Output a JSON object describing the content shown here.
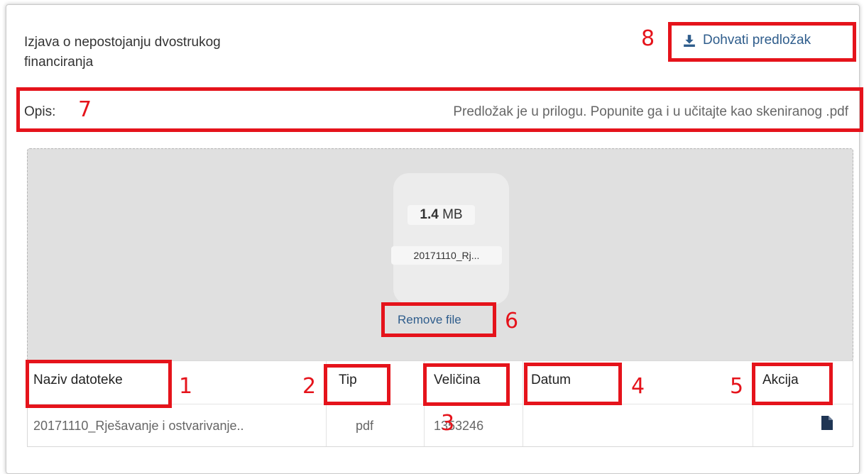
{
  "header": {
    "title": "Izjava o nepostojanju dvostrukog financiranja",
    "template_link": "Dohvati predložak",
    "template_icon": "download-icon"
  },
  "description": {
    "label": "Opis:",
    "text": "Predložak je u prilogu. Popunite ga i u učitajte kao skeniranog .pdf"
  },
  "dropzone": {
    "file_size_value": "1.4",
    "file_size_unit": "MB",
    "file_name": "20171110_Rj...",
    "remove_label": "Remove file"
  },
  "table": {
    "columns": [
      "Naziv datoteke",
      "Tip",
      "Veličina",
      "Datum",
      "Akcija"
    ],
    "rows": [
      {
        "name": "20171110_Rješavanje i ostvarivanje..",
        "type": "pdf",
        "size": "1353246",
        "date": "",
        "action_icon": "document-icon"
      }
    ]
  },
  "annotations": {
    "n1": "1",
    "n2": "2",
    "n3": "3",
    "n4": "4",
    "n5": "5",
    "n6": "6",
    "n7": "7",
    "n8": "8",
    "color": "#e5131b"
  },
  "colors": {
    "link": "#2f5d8c",
    "dropzone_bg": "#e0e0e0"
  }
}
